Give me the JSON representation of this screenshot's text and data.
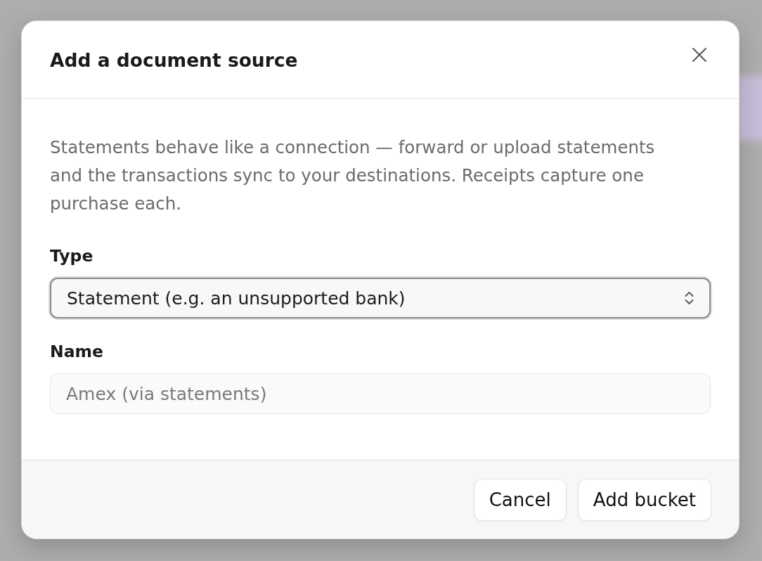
{
  "dialog": {
    "title": "Add a document source",
    "description": "Statements behave like a connection — forward or upload statements and the transactions sync to your destinations. Receipts capture one purchase each.",
    "fields": [
      {
        "kind": "select",
        "label": "Type",
        "value": "Statement (e.g. an unsupported bank)",
        "focused": true
      },
      {
        "kind": "text",
        "label": "Name",
        "placeholder": "Amex (via statements)",
        "focused": false
      }
    ],
    "buttons": [
      "Cancel",
      "Add bucket"
    ]
  }
}
